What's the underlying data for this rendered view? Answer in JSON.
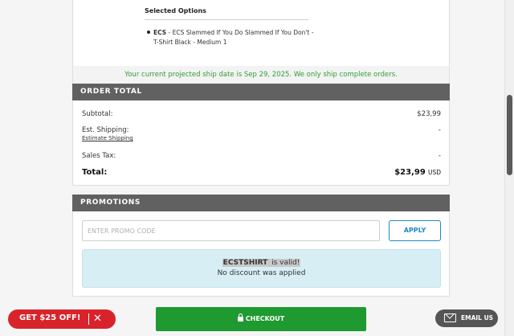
{
  "selected_options": {
    "title": "Selected Options",
    "item_code": "ECS",
    "item_text": " - ECS Slammed If You Do Slammed If You Don't - T-Shirt Black - Medium 1"
  },
  "ship_notice": "Your current projected ship date is Sep 29, 2025. We only ship complete orders.",
  "order_total": {
    "heading": "ORDER TOTAL",
    "subtotal_label": "Subtotal:",
    "subtotal_value": "$23,99",
    "shipping_label": "Est. Shipping:",
    "shipping_value": "-",
    "estimate_link": "Estimate Shipping",
    "tax_label": "Sales Tax:",
    "tax_value": "-",
    "total_label": "Total:",
    "total_value": "$23,99",
    "total_currency": "USD"
  },
  "promotions": {
    "heading": "PROMOTIONS",
    "input_placeholder": "ENTER PROMO CODE",
    "apply_label": "APPLY",
    "message_code": "ECSTSHIRT",
    "message_valid": " is valid!",
    "message_line2": "No discount was applied"
  },
  "footer": {
    "offer_label": "GET $25 OFF!",
    "offer_close": "✕",
    "checkout_label": "CHECKOUT",
    "email_label": "EMAIL US"
  },
  "colors": {
    "section_header": "#616161",
    "notice_green": "#2e9e3a",
    "apply_blue": "#1e88c9",
    "promo_message_bg": "#d7eef5",
    "offer_red": "#d8232a",
    "checkout_green": "#1f9a30",
    "email_gray": "#555555"
  }
}
